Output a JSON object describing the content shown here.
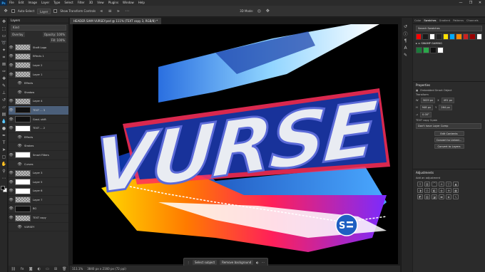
{
  "app": {
    "logo": "Ps"
  },
  "menu": [
    "File",
    "Edit",
    "Image",
    "Layer",
    "Type",
    "Select",
    "Filter",
    "3D",
    "View",
    "Plugins",
    "Window",
    "Help"
  ],
  "window_controls": {
    "minimize": "—",
    "maximize": "❐",
    "close": "✕"
  },
  "options_bar": {
    "auto_select_label": "Auto-Select",
    "auto_select_target": "Layer",
    "show_transform": "Show Transform Controls",
    "mode_3d": "3D Mode:"
  },
  "tools": [
    "move-icon",
    "artboard-icon",
    "marquee-icon",
    "lasso-icon",
    "quick-select-icon",
    "crop-icon",
    "frame-icon",
    "eyedropper-icon",
    "healing-icon",
    "brush-icon",
    "clone-stamp-icon",
    "history-brush-icon",
    "eraser-icon",
    "gradient-icon",
    "blur-icon",
    "dodge-icon",
    "pen-icon",
    "type-icon",
    "path-select-icon",
    "shape-icon",
    "hand-icon",
    "zoom-icon",
    "more-tools-icon"
  ],
  "layers_panel": {
    "tab": "Layers",
    "filter": "Kind",
    "blend_mode": "Overlay",
    "opacity_label": "Opacity: 100%",
    "fill_label": "Fill: 100%",
    "layers": [
      {
        "name": "Shaft Logo",
        "thumb": "checker"
      },
      {
        "name": "Effects 1",
        "thumb": "checker"
      },
      {
        "name": "Layer 2",
        "thumb": "checker"
      },
      {
        "name": "Layer 1",
        "thumb": "checker"
      },
      {
        "name": "Effects",
        "thumb": "none"
      },
      {
        "name": "Shadow",
        "thumb": "none"
      },
      {
        "name": "Layer 4",
        "thumb": "checker"
      },
      {
        "name": "TEXT ... 3",
        "thumb": "dark",
        "selected": true
      },
      {
        "name": "Grad. shift",
        "thumb": "dark"
      },
      {
        "name": "TEXT ... 2",
        "thumb": "white"
      },
      {
        "name": "Effects",
        "thumb": "none"
      },
      {
        "name": "Strokes",
        "thumb": "none"
      },
      {
        "name": "Smart Filters",
        "thumb": "white"
      },
      {
        "name": "Curves",
        "thumb": "none"
      },
      {
        "name": "Layer 3",
        "thumb": "checker"
      },
      {
        "name": "Layer 5",
        "thumb": "white"
      },
      {
        "name": "Layer 6",
        "thumb": "white"
      },
      {
        "name": "Layer 7",
        "thumb": "checker"
      },
      {
        "name": "BG",
        "thumb": "dark"
      },
      {
        "name": "TEXT copy",
        "thumb": "checker"
      },
      {
        "name": "VURSEY",
        "thumb": "none"
      }
    ],
    "bottom_icons": [
      "link-icon",
      "fx-icon",
      "mask-icon",
      "adjustment-icon",
      "folder-icon",
      "new-layer-icon",
      "trash-icon"
    ]
  },
  "document": {
    "tab_title": "HEADER SIAM VURSEY.psd @ 111% (TEXT copy 3, RGB/8) *",
    "zoom": "111.1%",
    "size_info": "3840 px x 2160 px (72 ppi)",
    "canvas_text": "VURSE"
  },
  "context_bar": {
    "select_subject": "Select subject",
    "remove_background": "Remove background"
  },
  "colors": {
    "bg": "#000000",
    "accent_blue": "#31a8ff",
    "badge_blue": "#1f5fc2",
    "selection": "#4b5f7a"
  },
  "swatches_panel": {
    "tabs": [
      "Color",
      "Swatches",
      "Gradient",
      "Patterns",
      "Channels"
    ],
    "active": "Swatches",
    "search_placeholder": "Search Swatches",
    "recent": [
      "#ff0000",
      "#1a1a1a",
      "#ffffff",
      "#222222",
      "#ffe100",
      "#00aaff",
      "#ff8800",
      "#cc2222",
      "#990000",
      "#ffffff"
    ],
    "group_name": "SWAMP GAMING",
    "group_colors": [
      "#1a7a3a",
      "#2aa84a",
      "#111111",
      "#ffffff"
    ]
  },
  "properties": {
    "title": "Properties",
    "kind": "Embedded Smart Object",
    "transform_label": "Transform",
    "w": "3029 px",
    "x": "491 px",
    "h": "948 px",
    "y": "264 px",
    "angle": "0.00°",
    "file_label": "TEXT copy 3.psb",
    "file_value": "Don't have Layer Comp",
    "edit_contents": "Edit Contents",
    "convert_linked": "Convert to Linked...",
    "convert_layers": "Convert to Layers"
  },
  "adjustments": {
    "title": "Adjustments",
    "add_label": "Add an adjustment",
    "icons": [
      "brightness",
      "levels",
      "curves",
      "exposure",
      "vibrance",
      "triangle",
      "hue-sat",
      "color-balance",
      "bw",
      "photo-filter",
      "channel-mixer",
      "lookup",
      "invert",
      "posterize",
      "threshold",
      "gradient-map",
      "selective-color",
      "curve2"
    ]
  }
}
